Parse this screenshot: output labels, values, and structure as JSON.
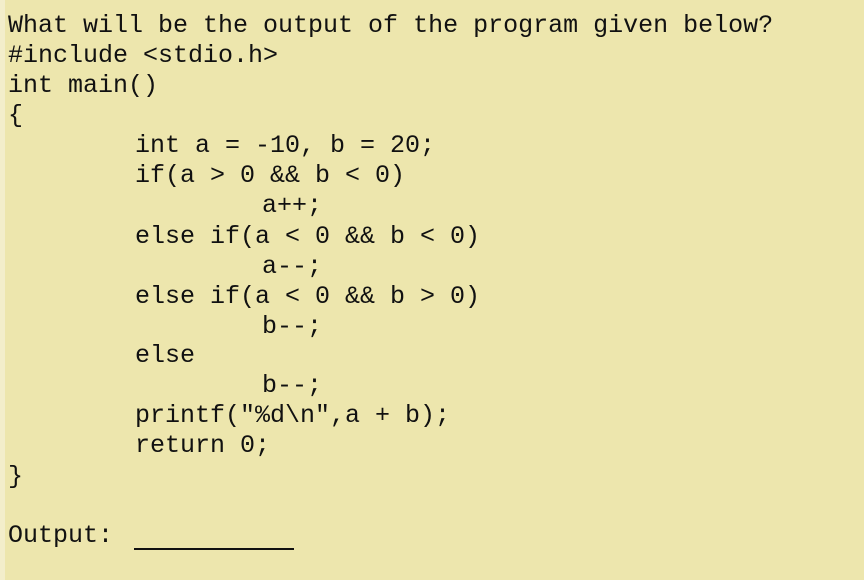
{
  "question": "What will be the output of the program given below?",
  "code": {
    "include": "#include <stdio.h>",
    "main_signature": "int main()",
    "open_brace": "{",
    "body": [
      "int a = -10, b = 20;",
      "if(a > 0 && b < 0)",
      "a++;",
      "else if(a < 0 && b < 0)",
      "a--;",
      "else if(a < 0 && b > 0)",
      "b--;",
      "else",
      "b--;",
      "printf(\"%d\\n\",a + b);",
      "return 0;"
    ],
    "close_brace": "}"
  },
  "answer": {
    "label": "Output:",
    "value": ""
  }
}
